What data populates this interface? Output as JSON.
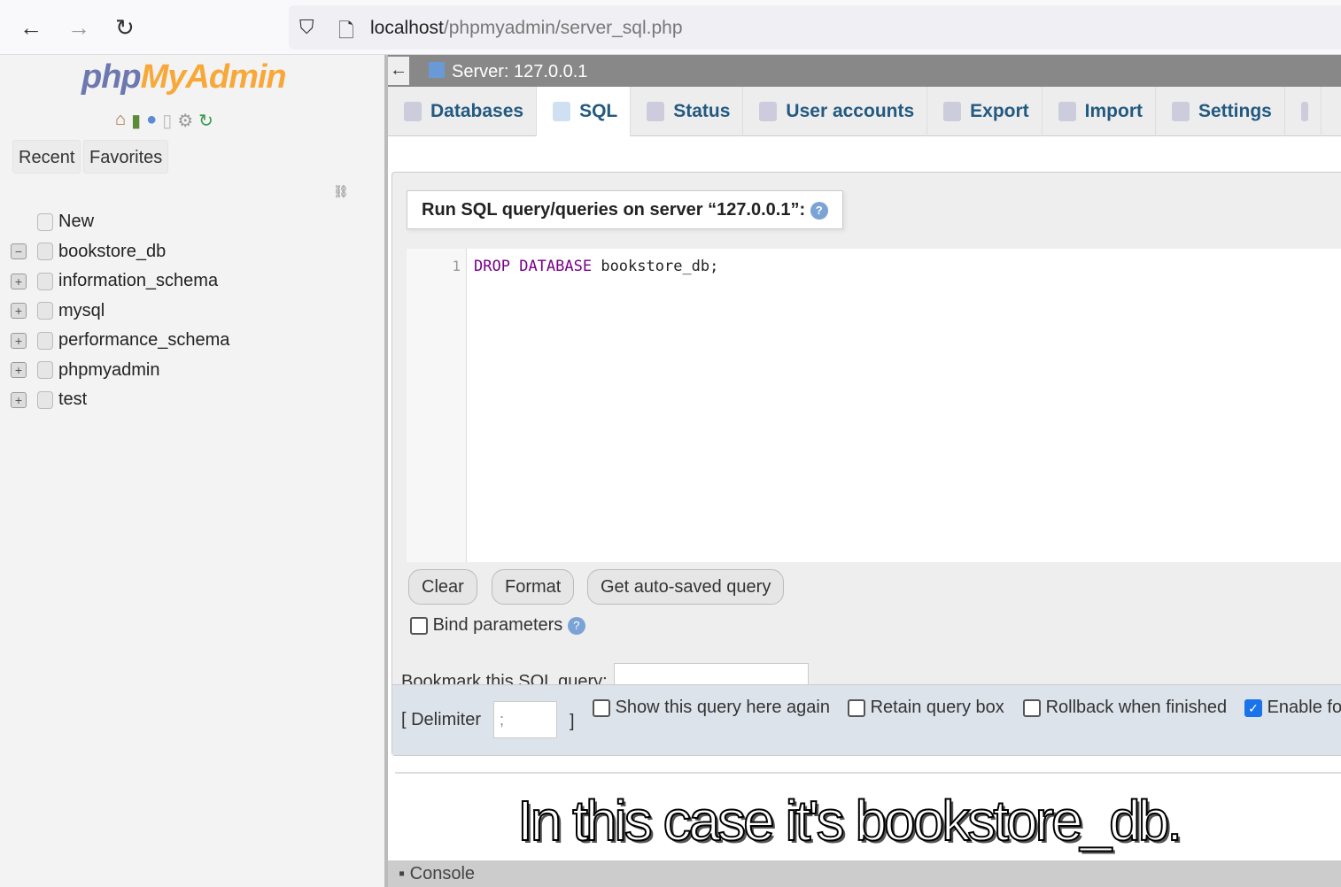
{
  "browser": {
    "url_host": "localhost",
    "url_path": "/phpmyadmin/server_sql.php"
  },
  "sidebar": {
    "logo_php": "php",
    "logo_myadmin": "MyAdmin",
    "recent": "Recent",
    "favorites": "Favorites",
    "tree": [
      {
        "label": "New",
        "expander": ""
      },
      {
        "label": "bookstore_db",
        "expander": "−"
      },
      {
        "label": "information_schema",
        "expander": "+"
      },
      {
        "label": "mysql",
        "expander": "+"
      },
      {
        "label": "performance_schema",
        "expander": "+"
      },
      {
        "label": "phpmyadmin",
        "expander": "+"
      },
      {
        "label": "test",
        "expander": "+"
      }
    ]
  },
  "server": {
    "title": "Server: 127.0.0.1"
  },
  "tabs": [
    {
      "label": "Databases"
    },
    {
      "label": "SQL",
      "active": true
    },
    {
      "label": "Status"
    },
    {
      "label": "User accounts"
    },
    {
      "label": "Export"
    },
    {
      "label": "Import"
    },
    {
      "label": "Settings"
    }
  ],
  "sql": {
    "legend": "Run SQL query/queries on server “127.0.0.1”:",
    "line_number": "1",
    "kw1": "DROP",
    "kw2": "DATABASE",
    "rest": " bookstore_db;",
    "clear": "Clear",
    "format": "Format",
    "autosaved": "Get auto-saved query",
    "bind_params": "Bind parameters",
    "bookmark_label": "Bookmark this SQL query:",
    "bookmark_value": "",
    "delimiter_label": "[ Delimiter",
    "delimiter_value": ";",
    "delimiter_close": "]",
    "show_again": "Show this query here again",
    "retain": "Retain query box",
    "rollback": "Rollback when finished",
    "enable_fk": "Enable fo"
  },
  "subtitle": "In this case it's bookstore_db.",
  "console": "Console"
}
